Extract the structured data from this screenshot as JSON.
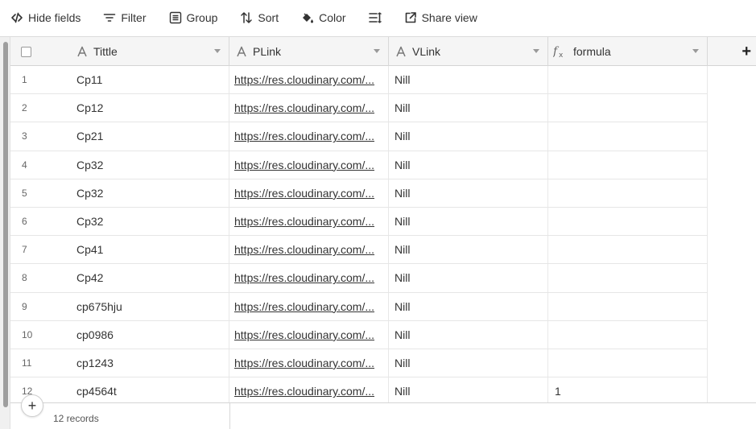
{
  "toolbar": {
    "hide_fields": "Hide fields",
    "filter": "Filter",
    "group": "Group",
    "sort": "Sort",
    "color": "Color",
    "share_view": "Share view"
  },
  "columns": {
    "title": "Tittle",
    "plink": "PLink",
    "vlink": "VLink",
    "formula": "formula"
  },
  "rows": [
    {
      "num": "1",
      "title": "Cp11",
      "plink": "https://res.cloudinary.com/...",
      "vlink": "Nill",
      "formula": ""
    },
    {
      "num": "2",
      "title": "Cp12",
      "plink": "https://res.cloudinary.com/...",
      "vlink": "Nill",
      "formula": ""
    },
    {
      "num": "3",
      "title": "Cp21",
      "plink": "https://res.cloudinary.com/...",
      "vlink": "Nill",
      "formula": ""
    },
    {
      "num": "4",
      "title": "Cp32",
      "plink": "https://res.cloudinary.com/...",
      "vlink": "Nill",
      "formula": ""
    },
    {
      "num": "5",
      "title": "Cp32",
      "plink": "https://res.cloudinary.com/...",
      "vlink": "Nill",
      "formula": ""
    },
    {
      "num": "6",
      "title": "Cp32",
      "plink": "https://res.cloudinary.com/...",
      "vlink": "Nill",
      "formula": ""
    },
    {
      "num": "7",
      "title": "Cp41",
      "plink": "https://res.cloudinary.com/...",
      "vlink": "Nill",
      "formula": ""
    },
    {
      "num": "8",
      "title": "Cp42",
      "plink": "https://res.cloudinary.com/...",
      "vlink": "Nill",
      "formula": ""
    },
    {
      "num": "9",
      "title": "cp675hju",
      "plink": "https://res.cloudinary.com/...",
      "vlink": "Nill",
      "formula": ""
    },
    {
      "num": "10",
      "title": "cp0986",
      "plink": "https://res.cloudinary.com/...",
      "vlink": "Nill",
      "formula": ""
    },
    {
      "num": "11",
      "title": "cp1243",
      "plink": "https://res.cloudinary.com/...",
      "vlink": "Nill",
      "formula": ""
    },
    {
      "num": "12",
      "title": "cp4564t",
      "plink": "https://res.cloudinary.com/...",
      "vlink": "Nill",
      "formula": "1"
    }
  ],
  "footer": {
    "add_row": "+",
    "record_count": "12 records"
  },
  "add_column": "+"
}
